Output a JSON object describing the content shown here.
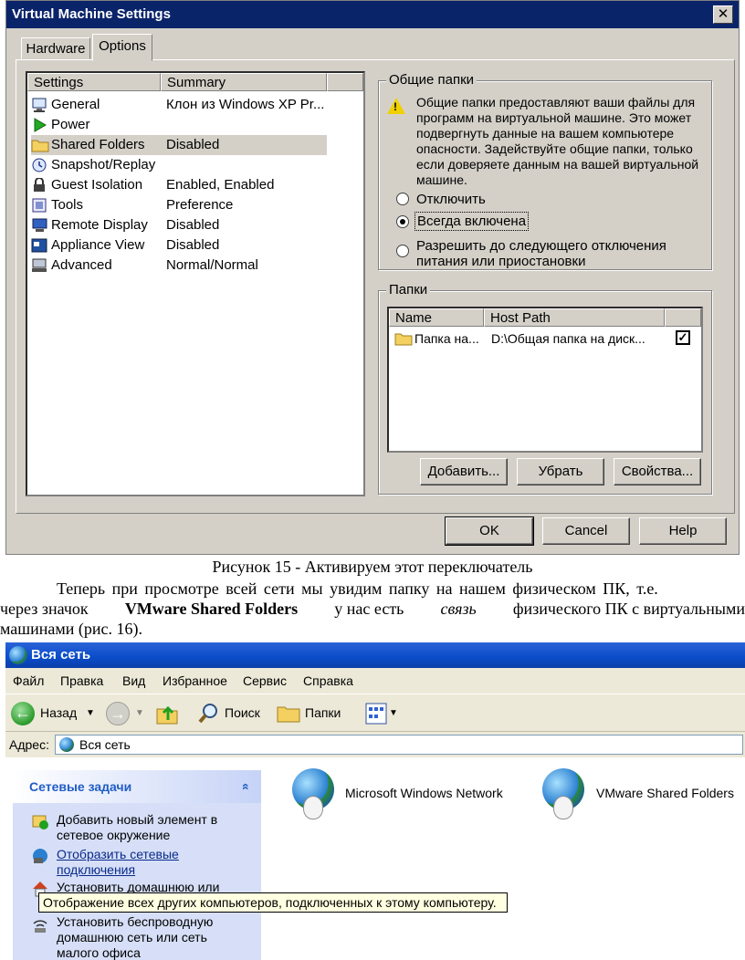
{
  "vm_dialog": {
    "title": "Virtual Machine Settings",
    "close_glyph": "✕",
    "tabs": [
      "Hardware",
      "Options"
    ],
    "active_tab": "Options",
    "columns": [
      "Settings",
      "Summary"
    ],
    "settings": [
      {
        "name": "General",
        "summary": "Клон из Windows XP Pr...",
        "icon": "monitor-icon"
      },
      {
        "name": "Power",
        "summary": "",
        "icon": "play-icon"
      },
      {
        "name": "Shared Folders",
        "summary": "Disabled",
        "icon": "folder-icon"
      },
      {
        "name": "Snapshot/Replay",
        "summary": "",
        "icon": "snapshot-icon"
      },
      {
        "name": "Guest Isolation",
        "summary": "Enabled, Enabled",
        "icon": "lock-icon"
      },
      {
        "name": "Tools",
        "summary": "Preference",
        "icon": "tools-icon"
      },
      {
        "name": "Remote Display",
        "summary": "Disabled",
        "icon": "display-icon"
      },
      {
        "name": "Appliance View",
        "summary": "Disabled",
        "icon": "appliance-icon"
      },
      {
        "name": "Advanced",
        "summary": "Normal/Normal",
        "icon": "computer-icon"
      }
    ],
    "selected_setting": "Shared Folders",
    "shared_group": {
      "title": "Общие папки",
      "warning": "Общие папки предоставляют ваши файлы для программ на виртуальной машине. Это может подвергнуть данные на вашем компьютере опасности. Задействуйте общие папки, только если доверяете данным на вашей виртуальной машине.",
      "options": [
        "Отключить",
        "Всегда включена",
        "Разрешить до следующего отключения питания или приостановки"
      ],
      "selected_option": "Всегда включена"
    },
    "folders_group": {
      "title": "Папки",
      "columns": [
        "Name",
        "Host Path"
      ],
      "rows": [
        {
          "name": "Папка на...",
          "host_path": "D:\\Общая папка на диск...",
          "checked": true
        }
      ],
      "check_glyph": "✓",
      "buttons": [
        "Добавить...",
        "Убрать",
        "Свойства..."
      ]
    },
    "footer_buttons": [
      "OK",
      "Cancel",
      "Help"
    ]
  },
  "document": {
    "caption": "Рисунок 15 - Активируем этот переключатель",
    "para_line1": "Теперь при просмотре всей сети мы увидим папку на нашем физическом ПК, т.е.",
    "para_line2_a": "через значок",
    "para_line2_bold": "VMware Shared Folders",
    "para_line2_b": "у нас есть",
    "para_line2_italic": "связь",
    "para_line2_c": "физического ПК с виртуальными",
    "para_line3": "машинами (рис. 16)."
  },
  "explorer": {
    "title": "Вся сеть",
    "menu": [
      "Файл",
      "Правка",
      "Вид",
      "Избранное",
      "Сервис",
      "Справка"
    ],
    "toolbar": {
      "back": "Назад",
      "search": "Поиск",
      "folders": "Папки"
    },
    "address_label": "Адрес:",
    "address_value": "Вся сеть",
    "task_pane": {
      "title": "Сетевые задачи",
      "collapse_glyph": "«",
      "items": [
        "Добавить новый элемент в сетевое окружение",
        "Отобразить сетевые подключения",
        "Установить домашнюю или",
        "Установить беспроводную домашнюю сеть или сеть малого офиса"
      ]
    },
    "tooltip": "Отображение всех других компьютеров, подключенных к этому компьютеру.",
    "networks": [
      "Microsoft Windows Network",
      "VMware Shared Folders"
    ]
  }
}
